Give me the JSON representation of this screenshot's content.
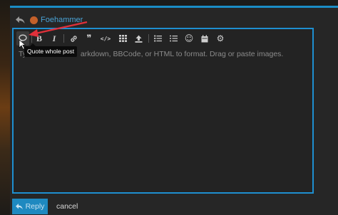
{
  "header": {
    "username": "Foehammer"
  },
  "toolbar": {
    "buttons": [
      {
        "name": "quote-whole-post-icon"
      },
      {
        "name": "bold-icon",
        "glyph": "B"
      },
      {
        "name": "italic-icon",
        "glyph": "I"
      },
      {
        "name": "link-icon"
      },
      {
        "name": "blockquote-icon",
        "glyph": "❞"
      },
      {
        "name": "code-icon",
        "glyph": "</>"
      },
      {
        "name": "table-icon"
      },
      {
        "name": "upload-icon"
      },
      {
        "name": "bullet-list-icon"
      },
      {
        "name": "numbered-list-icon"
      },
      {
        "name": "emoji-icon",
        "glyph": "☺"
      },
      {
        "name": "calendar-icon"
      },
      {
        "name": "gear-icon",
        "glyph": "⚙"
      }
    ],
    "tooltip": "Quote whole post"
  },
  "editor": {
    "placeholder": "Ty                          arkdown, BBCode, or HTML to format. Drag or paste images."
  },
  "footer": {
    "reply_label": "Reply",
    "cancel_label": "cancel"
  },
  "colors": {
    "accent": "#1e8fd0",
    "username": "#4aa3d6",
    "annotation_arrow": "#e0303a"
  }
}
